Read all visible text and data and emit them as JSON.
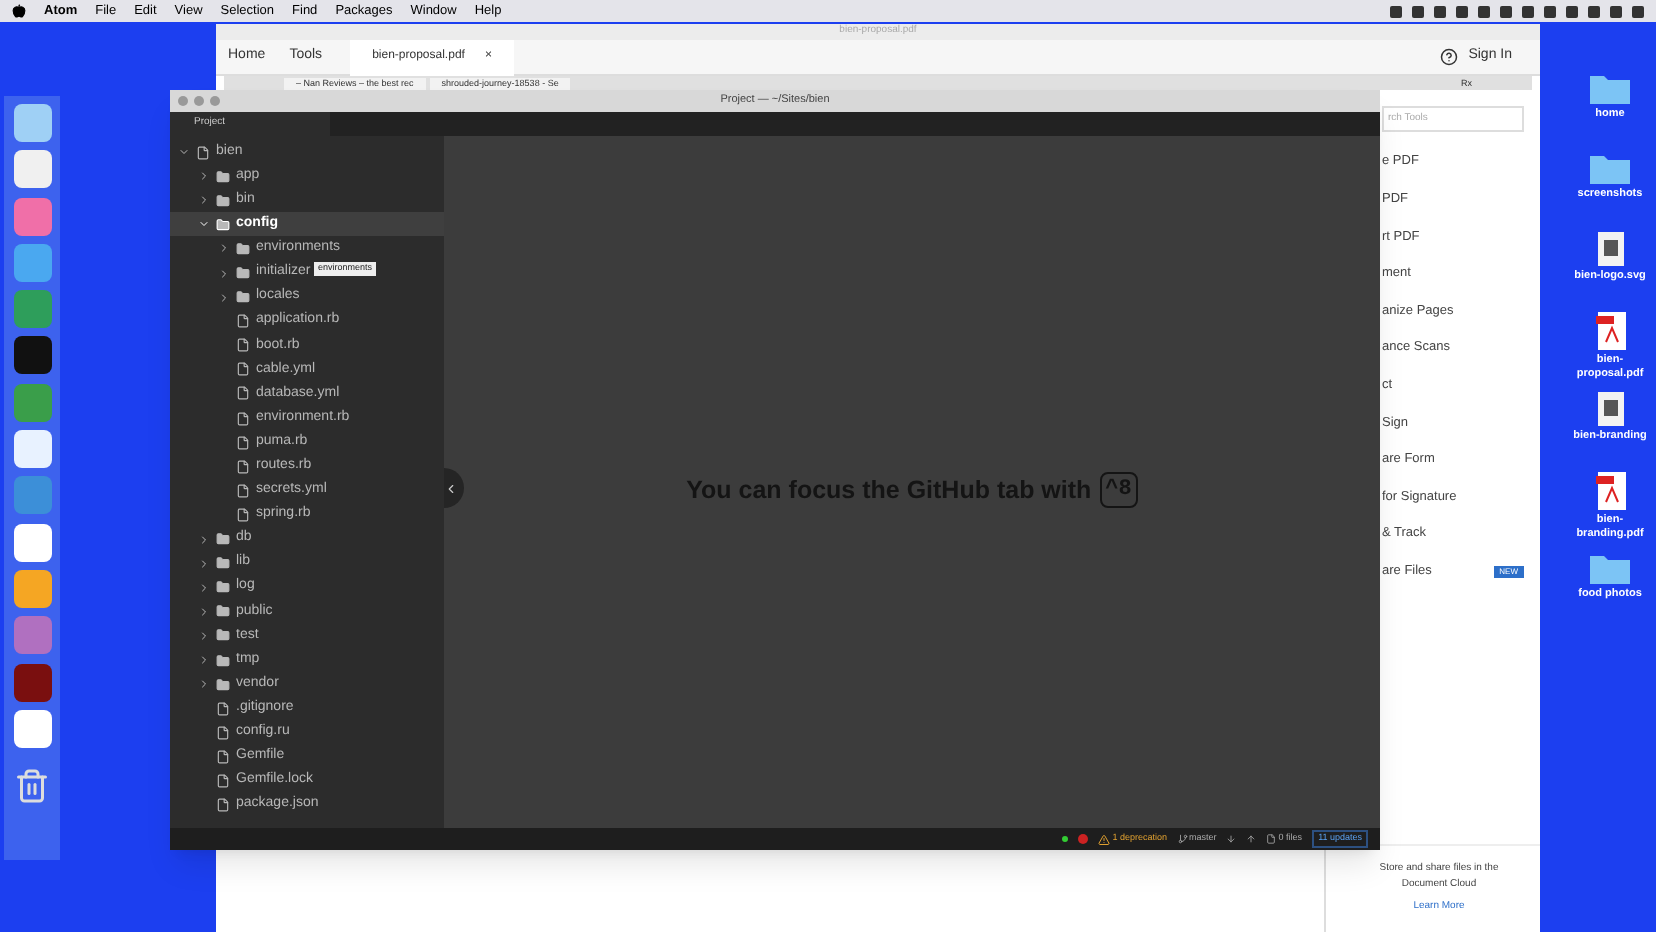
{
  "menu_bar": {
    "app": "Atom",
    "items": [
      "File",
      "Edit",
      "View",
      "Selection",
      "Find",
      "Packages",
      "Window",
      "Help"
    ]
  },
  "acrobat_window": {
    "title": "bien-proposal.pdf",
    "nav": [
      "Home",
      "Tools"
    ],
    "tab": "bien-proposal.pdf",
    "tab_close": "×",
    "sign_in": "Sign In",
    "browser_tabs": [
      "– Nan Reviews – the best rec",
      "shrouded-journey-18538 - Se"
    ],
    "browser_corner": "Rx",
    "search": {
      "placeholder": "rch Tools"
    },
    "tools": [
      {
        "label": "e PDF"
      },
      {
        "label": "PDF"
      },
      {
        "label": "rt PDF"
      },
      {
        "label": "ment"
      },
      {
        "label": "anize Pages"
      },
      {
        "label": "ance Scans"
      },
      {
        "label": "ct"
      },
      {
        "label": "Sign"
      },
      {
        "label": "are Form"
      },
      {
        "label": "for Signature"
      },
      {
        "label": "& Track"
      },
      {
        "label": "are Files",
        "badge": "NEW"
      }
    ],
    "footer": [
      "Store and share files in the",
      "Document Cloud"
    ],
    "footer_link": "Learn More"
  },
  "atom_window": {
    "title": "Project — ~/Sites/bien",
    "panel_tab": "Project",
    "tree": [
      {
        "name": "bien",
        "kind": "root",
        "expanded": true,
        "selected": false,
        "children": [
          {
            "name": "app",
            "kind": "folder",
            "expanded": false,
            "selected": false
          },
          {
            "name": "bin",
            "kind": "folder",
            "expanded": false,
            "selected": false
          },
          {
            "name": "config",
            "kind": "folder",
            "expanded": true,
            "selected": true,
            "children": [
              {
                "name": "environments",
                "kind": "folder",
                "expanded": false,
                "selected": false
              },
              {
                "name": "initializer",
                "kind": "folder",
                "expanded": false,
                "selected": false
              },
              {
                "name": "locales",
                "kind": "folder",
                "expanded": false,
                "selected": false
              },
              {
                "name": "application.rb",
                "kind": "file",
                "selected": false
              },
              {
                "name": "boot.rb",
                "kind": "file",
                "selected": false
              },
              {
                "name": "cable.yml",
                "kind": "file",
                "selected": false
              },
              {
                "name": "database.yml",
                "kind": "file",
                "selected": false
              },
              {
                "name": "environment.rb",
                "kind": "file",
                "selected": false
              },
              {
                "name": "puma.rb",
                "kind": "file",
                "selected": false
              },
              {
                "name": "routes.rb",
                "kind": "file",
                "selected": false
              },
              {
                "name": "secrets.yml",
                "kind": "file",
                "selected": false
              },
              {
                "name": "spring.rb",
                "kind": "file",
                "selected": false
              }
            ]
          },
          {
            "name": "db",
            "kind": "folder",
            "expanded": false,
            "selected": false
          },
          {
            "name": "lib",
            "kind": "folder",
            "expanded": false,
            "selected": false
          },
          {
            "name": "log",
            "kind": "folder",
            "expanded": false,
            "selected": false
          },
          {
            "name": "public",
            "kind": "folder",
            "expanded": false,
            "selected": false
          },
          {
            "name": "test",
            "kind": "folder",
            "expanded": false,
            "selected": false
          },
          {
            "name": "tmp",
            "kind": "folder",
            "expanded": false,
            "selected": false
          },
          {
            "name": "vendor",
            "kind": "folder",
            "expanded": false,
            "selected": false
          },
          {
            "name": ".gitignore",
            "kind": "file",
            "selected": false
          },
          {
            "name": "config.ru",
            "kind": "file",
            "selected": false
          },
          {
            "name": "Gemfile",
            "kind": "file",
            "selected": false
          },
          {
            "name": "Gemfile.lock",
            "kind": "file",
            "selected": false
          },
          {
            "name": "package.json",
            "kind": "file",
            "selected": false
          }
        ]
      }
    ],
    "tooltip": "environments",
    "message": "You can focus the GitHub tab with",
    "shortcut": "^8",
    "status": {
      "deprecations": "1 deprecation",
      "branch": "master",
      "files": "0 files",
      "updates": "11 updates"
    }
  },
  "desktop_icons": [
    {
      "label": "home",
      "kind": "folder"
    },
    {
      "label": "screenshots",
      "kind": "folder"
    },
    {
      "label": "bien-logo.svg",
      "kind": "image"
    },
    {
      "label": "bien-proposal.pdf",
      "kind": "pdf"
    },
    {
      "label": "bien-branding",
      "kind": "image"
    },
    {
      "label": "bien-branding.pdf",
      "kind": "pdf"
    },
    {
      "label": "food photos",
      "kind": "folder"
    }
  ]
}
